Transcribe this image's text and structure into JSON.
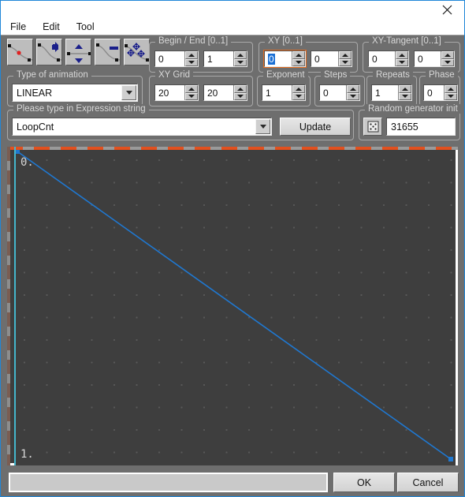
{
  "window": {
    "close_label": "×"
  },
  "menubar": {
    "items": [
      {
        "label": "File"
      },
      {
        "label": "Edit"
      },
      {
        "label": "Tool"
      }
    ]
  },
  "toolbar": {
    "buttons": [
      {
        "name": "add-point-tool",
        "tooltip": "Add point"
      },
      {
        "name": "move-point-tool",
        "tooltip": "Move point"
      },
      {
        "name": "vertical-flip-tool",
        "tooltip": "Flip vertical"
      },
      {
        "name": "delete-point-tool",
        "tooltip": "Delete point"
      },
      {
        "name": "move-all-points-tool",
        "tooltip": "Move all points"
      }
    ]
  },
  "animation_type": {
    "legend": "Type of animation",
    "value": "LINEAR",
    "options": [
      "LINEAR"
    ]
  },
  "begin_end": {
    "legend": "Begin / End [0..1]",
    "begin": "0",
    "end": "1"
  },
  "xy": {
    "legend": "XY [0..1]",
    "x": "0",
    "y": "0",
    "focused_field": "x"
  },
  "xy_tangent": {
    "legend": "XY-Tangent [0..1]",
    "x": "0",
    "y": "0"
  },
  "xy_grid": {
    "legend": "XY Grid",
    "x": "20",
    "y": "20"
  },
  "exponent": {
    "legend": "Exponent",
    "value": "1"
  },
  "steps": {
    "legend": "Steps",
    "value": "0"
  },
  "repeats": {
    "legend": "Repeats",
    "value": "1"
  },
  "phase": {
    "legend": "Phase",
    "value": "0"
  },
  "expression": {
    "legend": "Please type in Expression string",
    "value": "LoopCnt",
    "placeholder": "",
    "update_label": "Update"
  },
  "random_init": {
    "legend": "Random generator init",
    "value": "31655"
  },
  "graph": {
    "label_top": "0.",
    "label_bottom": "1.",
    "curve_color": "#1f78d1",
    "background_color": "#3e3e3e",
    "grid_dot_color": "#595959",
    "selection_edge_color": "#e2501e",
    "axis_edge_color": "#45b6cc",
    "points": [
      {
        "x": 0.0,
        "y": 0.0
      },
      {
        "x": 1.0,
        "y": 1.0
      }
    ]
  },
  "statusbar": {
    "text": ""
  },
  "footer": {
    "ok_label": "OK",
    "cancel_label": "Cancel"
  }
}
